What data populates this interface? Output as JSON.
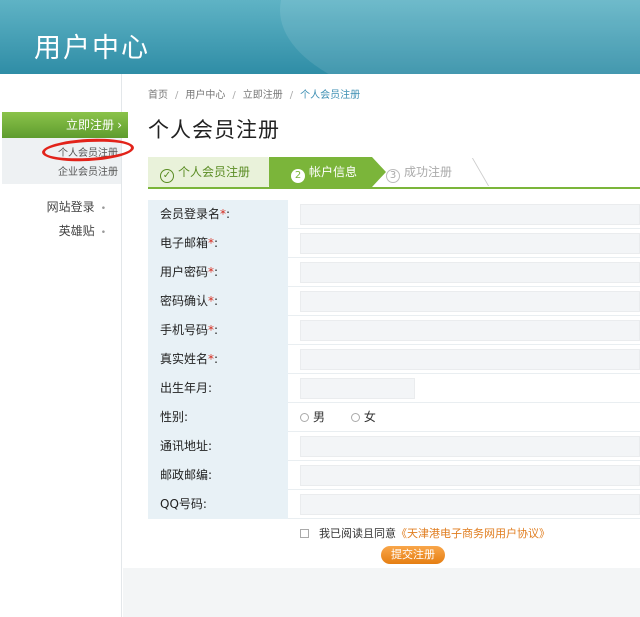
{
  "header": {
    "title": "用户中心"
  },
  "sidebar": {
    "active_label": "立即注册",
    "sub_items": [
      {
        "label": "个人会员注册"
      },
      {
        "label": "企业会员注册"
      }
    ],
    "links": [
      {
        "label": "网站登录"
      },
      {
        "label": "英雄贴"
      }
    ]
  },
  "breadcrumb": [
    "首页",
    "用户中心",
    "立即注册",
    "个人会员注册"
  ],
  "page_title": "个人会员注册",
  "steps": [
    {
      "number": "✓",
      "label": "个人会员注册"
    },
    {
      "number": "2",
      "label": "帐户信息"
    },
    {
      "number": "3",
      "label": "成功注册"
    }
  ],
  "form": {
    "fields": [
      {
        "label": "会员登录名",
        "required": "*",
        "suffix": ":"
      },
      {
        "label": "电子邮箱",
        "required": "*",
        "suffix": ":"
      },
      {
        "label": "用户密码",
        "required": "*",
        "suffix": ":"
      },
      {
        "label": "密码确认",
        "required": "*",
        "suffix": ":"
      },
      {
        "label": "手机号码",
        "required": "*",
        "suffix": ":"
      },
      {
        "label": "真实姓名",
        "required": "*",
        "suffix": ":"
      },
      {
        "label": "出生年月",
        "suffix": ":"
      },
      {
        "label": "性别",
        "suffix": ":"
      },
      {
        "label": "通讯地址",
        "suffix": ":"
      },
      {
        "label": "邮政邮编",
        "suffix": ":"
      },
      {
        "label": "QQ号码",
        "suffix": ":"
      }
    ],
    "gender_options": [
      "男",
      "女"
    ],
    "agree_text": "我已阅读且同意",
    "agree_link": "《天津港电子商务网用户协议》",
    "submit_label": "提交注册"
  },
  "colors": {
    "header": "#2f8da6",
    "accent_green": "#7bb53a",
    "label_bg": "#e8f1f6",
    "required": "#d52b1e",
    "button_orange": "#e57e12",
    "annotation_red": "#e2231a"
  }
}
